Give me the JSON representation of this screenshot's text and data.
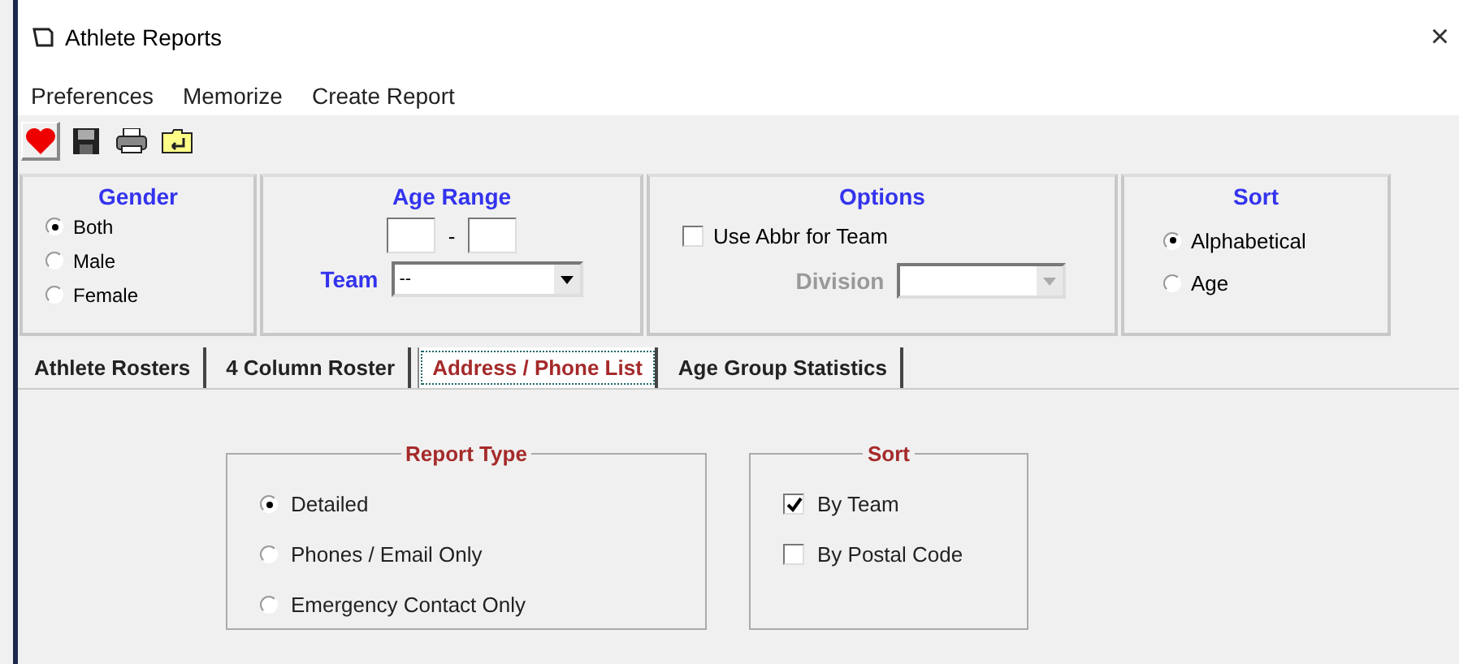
{
  "window": {
    "title": "Athlete Reports",
    "close": "×"
  },
  "menu": [
    "Preferences",
    "Memorize",
    "Create Report"
  ],
  "toolbar": [
    {
      "kind": "heart",
      "selected": true
    },
    {
      "kind": "save",
      "selected": false
    },
    {
      "kind": "print",
      "selected": false
    },
    {
      "kind": "folder",
      "selected": false
    }
  ],
  "gender": {
    "title": "Gender",
    "options": [
      {
        "label": "Both",
        "selected": true
      },
      {
        "label": "Male",
        "selected": false
      },
      {
        "label": "Female",
        "selected": false
      }
    ]
  },
  "age_range": {
    "title": "Age Range",
    "separator": "-",
    "team_label": "Team",
    "team_value": "--"
  },
  "options": {
    "title": "Options",
    "use_abbr": {
      "label": "Use Abbr for Team",
      "checked": false
    },
    "division_label": "Division",
    "division_disabled": true
  },
  "sort": {
    "title": "Sort",
    "options": [
      {
        "label": "Alphabetical",
        "selected": true
      },
      {
        "label": "Age",
        "selected": false
      }
    ]
  },
  "tabs": [
    {
      "label": "Athlete Rosters",
      "selected": false
    },
    {
      "label": "4 Column Roster",
      "selected": false
    },
    {
      "label": "Address / Phone List",
      "selected": true
    },
    {
      "label": "Age Group Statistics",
      "selected": false
    }
  ],
  "report_type": {
    "title": "Report Type",
    "options": [
      {
        "label": "Detailed",
        "selected": true
      },
      {
        "label": "Phones / Email Only",
        "selected": false
      },
      {
        "label": "Emergency Contact Only",
        "selected": false
      }
    ]
  },
  "list_sort": {
    "title": "Sort",
    "options": [
      {
        "label": "By Team",
        "checked": true
      },
      {
        "label": "By Postal Code",
        "checked": false
      }
    ]
  }
}
